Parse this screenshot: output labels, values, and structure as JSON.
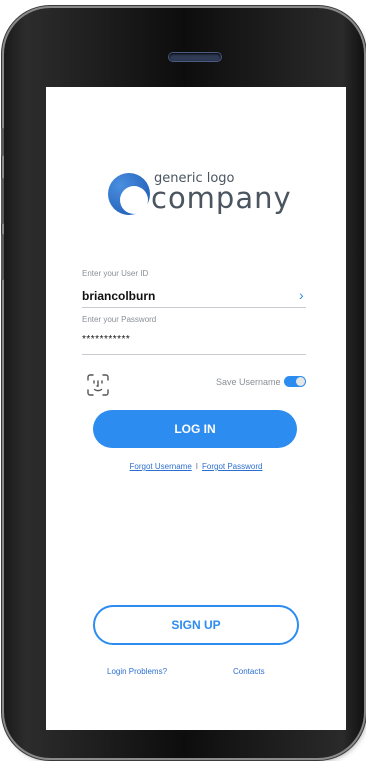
{
  "logo": {
    "small_text": "generic logo",
    "big_text": "company"
  },
  "login_form": {
    "user_id_label": "Enter your User ID",
    "user_id_value": "briancolburn",
    "password_label": "Enter your Password",
    "password_value": "***********",
    "save_username_label": "Save Username",
    "save_username_on": true
  },
  "buttons": {
    "login_label": "LOG IN",
    "signup_label": "SIGN UP"
  },
  "links": {
    "forgot_username": "Forgot Username",
    "separator": "I",
    "forgot_password": "Forgot Password",
    "login_problems": "Login Problems?",
    "contacts": "Contacts"
  },
  "icons": {
    "next_field": "chevron-right-icon",
    "biometric": "face-id-icon"
  },
  "colors": {
    "accent": "#2d8cf0",
    "link": "#2d6fd0",
    "phone_body": "#111111"
  }
}
